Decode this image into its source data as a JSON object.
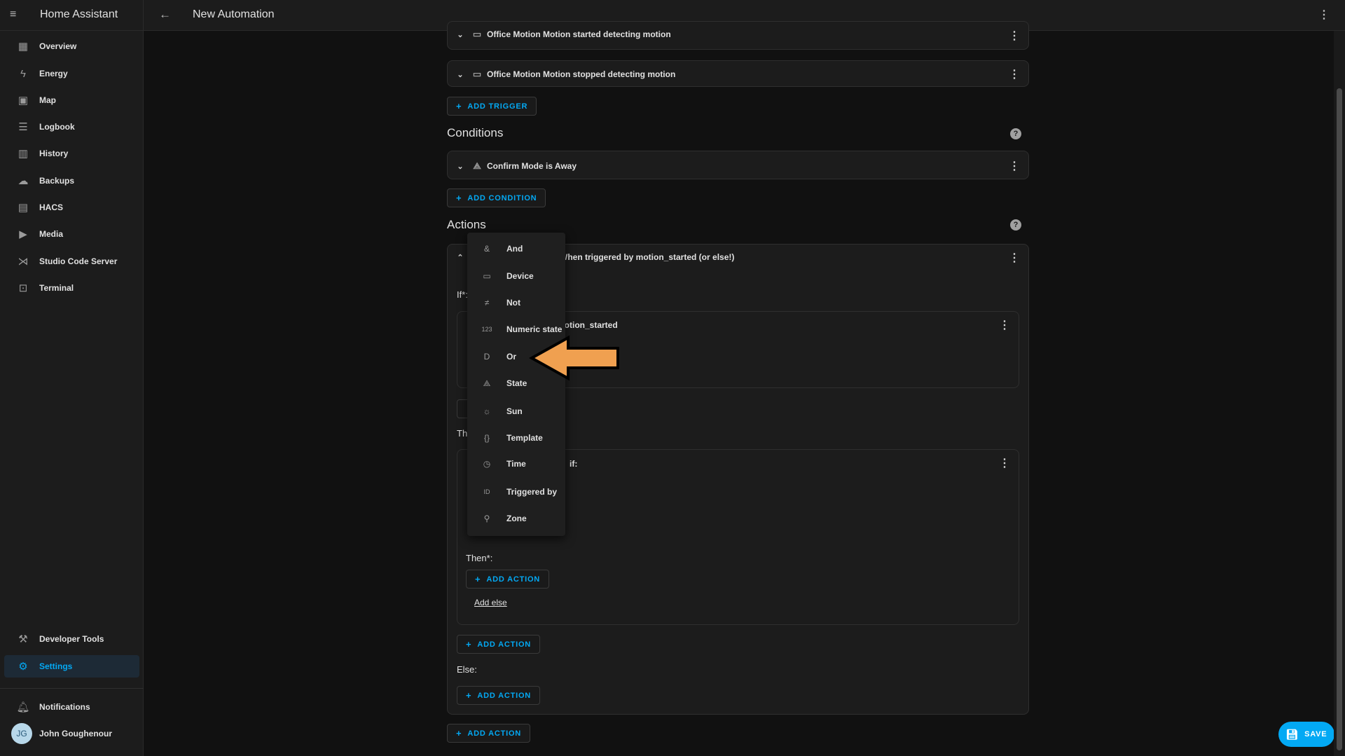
{
  "sidebar": {
    "title": "Home Assistant",
    "items": [
      {
        "label": "Overview",
        "icon": "dashboard-icon"
      },
      {
        "label": "Energy",
        "icon": "lightning-icon"
      },
      {
        "label": "Map",
        "icon": "map-icon"
      },
      {
        "label": "Logbook",
        "icon": "list-icon"
      },
      {
        "label": "History",
        "icon": "chart-icon"
      },
      {
        "label": "Backups",
        "icon": "cloud-icon"
      },
      {
        "label": "HACS",
        "icon": "hacs-icon"
      },
      {
        "label": "Media",
        "icon": "media-icon"
      },
      {
        "label": "Studio Code Server",
        "icon": "vscode-icon"
      },
      {
        "label": "Terminal",
        "icon": "terminal-icon"
      }
    ],
    "developer_tools": "Developer Tools",
    "settings": "Settings",
    "notifications": "Notifications",
    "user_initials": "JG",
    "user_name": "John Goughenour"
  },
  "header": {
    "title": "New Automation"
  },
  "triggers": [
    "Office Motion Motion started detecting motion",
    "Office Motion Motion stopped detecting motion"
  ],
  "add_trigger": "ADD TRIGGER",
  "conditions": {
    "heading": "Conditions",
    "items": [
      "Confirm Mode is Away"
    ],
    "add": "ADD CONDITION"
  },
  "actions": {
    "heading": "Actions",
    "item_title": "When triggered by motion_started (or else!)",
    "if_label": "If*:",
    "cond_title": "motion_started",
    "then_label": "Th",
    "nested_title": "if:",
    "nested_then": "Then*:",
    "add_action": "ADD ACTION",
    "add_else": "Add else",
    "else_label": "Else:"
  },
  "menu": [
    {
      "label": "And",
      "icon": "&"
    },
    {
      "label": "Device",
      "icon": "▭"
    },
    {
      "label": "Not",
      "icon": "≠"
    },
    {
      "label": "Numeric state",
      "icon": "123"
    },
    {
      "label": "Or",
      "icon": "D"
    },
    {
      "label": "State",
      "icon": "⟁"
    },
    {
      "label": "Sun",
      "icon": "☼"
    },
    {
      "label": "Template",
      "icon": "{}"
    },
    {
      "label": "Time",
      "icon": "◷"
    },
    {
      "label": "Triggered by",
      "icon": "ID"
    },
    {
      "label": "Zone",
      "icon": "⚲"
    }
  ],
  "save": "SAVE",
  "colors": {
    "accent": "#03a9f4",
    "arrow": "#f0a050"
  }
}
